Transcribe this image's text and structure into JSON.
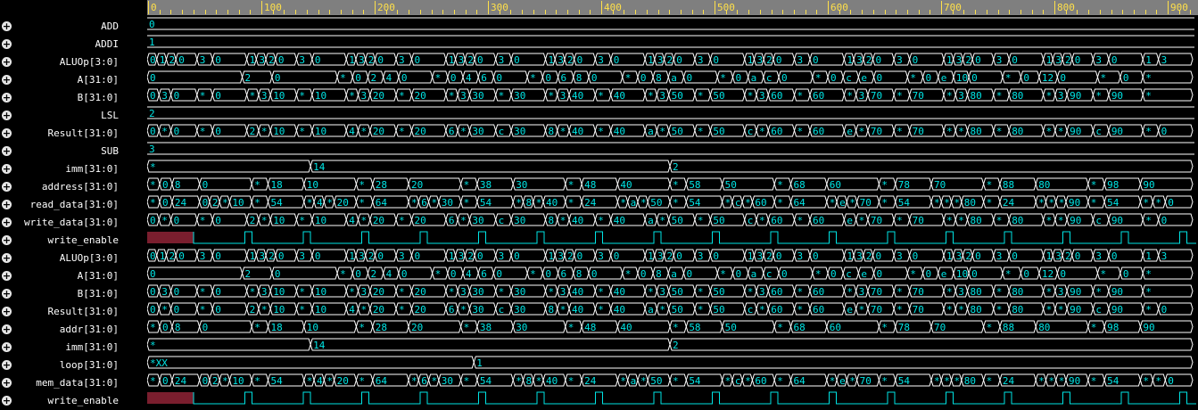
{
  "colors": {
    "wave": "#00e5e5",
    "ruler_bg": "#7f7f7f",
    "ruler_text": "#ffe04a",
    "undefined_fill": "#7a1e2e",
    "name_text": "#ffffff"
  },
  "icons": {
    "expand": "plus-circle-icon"
  },
  "timeline": {
    "ticks": [
      "0",
      "100",
      "200",
      "300",
      "400",
      "500",
      "600",
      "700",
      "800",
      "900"
    ]
  },
  "signals": [
    {
      "name": "ADD",
      "type": "const",
      "value": "0"
    },
    {
      "name": "ADDI",
      "type": "const",
      "value": "1"
    },
    {
      "name": "ALUOp[3:0]",
      "type": "bus",
      "pattern": "alu"
    },
    {
      "name": "A[31:0]",
      "type": "bus",
      "pattern": "a"
    },
    {
      "name": "B[31:0]",
      "type": "bus",
      "pattern": "b"
    },
    {
      "name": "LSL",
      "type": "const",
      "value": "2"
    },
    {
      "name": "Result[31:0]",
      "type": "bus",
      "pattern": "res"
    },
    {
      "name": "SUB",
      "type": "const",
      "value": "3"
    },
    {
      "name": "imm[31:0]",
      "type": "bus",
      "pattern": "imm"
    },
    {
      "name": "address[31:0]",
      "type": "bus",
      "pattern": "addr"
    },
    {
      "name": "read_data[31:0]",
      "type": "bus",
      "pattern": "rd"
    },
    {
      "name": "write_data[31:0]",
      "type": "bus",
      "pattern": "wd"
    },
    {
      "name": "write_enable",
      "type": "bit"
    },
    {
      "name": "ALUOp[3:0]",
      "type": "bus",
      "pattern": "alu"
    },
    {
      "name": "A[31:0]",
      "type": "bus",
      "pattern": "a"
    },
    {
      "name": "B[31:0]",
      "type": "bus",
      "pattern": "b"
    },
    {
      "name": "Result[31:0]",
      "type": "bus",
      "pattern": "res"
    },
    {
      "name": "addr[31:0]",
      "type": "bus",
      "pattern": "addr"
    },
    {
      "name": "imm[31:0]",
      "type": "bus",
      "pattern": "imm"
    },
    {
      "name": "loop[31:0]",
      "type": "bus",
      "pattern": "loop"
    },
    {
      "name": "mem_data[31:0]",
      "type": "bus",
      "pattern": "rd"
    },
    {
      "name": "write_enable",
      "type": "bit"
    }
  ],
  "patterns": {
    "alu": [
      [
        "0",
        "1",
        "2",
        "0"
      ],
      [
        "3",
        "0"
      ],
      [
        "1",
        "3",
        "2",
        "0"
      ],
      [
        "3",
        "0"
      ],
      [
        "1",
        "3",
        "2",
        "0"
      ],
      [
        "3",
        "0"
      ],
      [
        "1",
        "3",
        "2",
        "0"
      ],
      [
        "3",
        "0"
      ],
      [
        "1",
        "3",
        "2",
        "0"
      ],
      [
        "3",
        "0"
      ],
      [
        "1",
        "3",
        "2",
        "0"
      ],
      [
        "3",
        "0"
      ],
      [
        "1",
        "3",
        "2",
        "0"
      ],
      [
        "3",
        "0"
      ],
      [
        "1",
        "3",
        "2",
        "0"
      ],
      [
        "3",
        "0"
      ],
      [
        "1",
        "3",
        "2",
        "0"
      ],
      [
        "3",
        "0"
      ],
      [
        "1",
        "3",
        "2",
        "0"
      ],
      [
        "3",
        "0"
      ],
      [
        "1",
        "3"
      ]
    ],
    "a": [
      [
        "0"
      ],
      [
        "2",
        "0"
      ],
      [
        "*",
        "0",
        "2",
        "4",
        "0"
      ],
      [
        "*",
        "0",
        "4",
        "6",
        "0"
      ],
      [
        "*",
        "0",
        "6",
        "8",
        "0"
      ],
      [
        "*",
        "0",
        "8",
        "a",
        "0"
      ],
      [
        "*",
        "0",
        "a",
        "c",
        "0"
      ],
      [
        "*",
        "0",
        "c",
        "e",
        "0"
      ],
      [
        "*",
        "0",
        "e",
        "10",
        "0"
      ],
      [
        "*",
        "0",
        "12",
        "0"
      ],
      [
        "*",
        "0",
        "*"
      ]
    ],
    "b": [
      [
        "0",
        "3",
        "0"
      ],
      [
        "*",
        "0"
      ],
      [
        "*",
        "3",
        "10"
      ],
      [
        "*",
        "10"
      ],
      [
        "*",
        "3",
        "20"
      ],
      [
        "*",
        "20"
      ],
      [
        "*",
        "3",
        "30"
      ],
      [
        "*",
        "30"
      ],
      [
        "*",
        "3",
        "40"
      ],
      [
        "*",
        "40"
      ],
      [
        "*",
        "3",
        "50"
      ],
      [
        "*",
        "50"
      ],
      [
        "*",
        "3",
        "60"
      ],
      [
        "*",
        "60"
      ],
      [
        "*",
        "3",
        "70"
      ],
      [
        "*",
        "70"
      ],
      [
        "*",
        "3",
        "80"
      ],
      [
        "*",
        "80"
      ],
      [
        "*",
        "3",
        "90"
      ],
      [
        "*",
        "90"
      ],
      [
        "*"
      ]
    ],
    "res": [
      [
        "0",
        "*",
        "0"
      ],
      [
        "*",
        "0"
      ],
      [
        "2",
        "*",
        "10"
      ],
      [
        "*",
        "10"
      ],
      [
        "4",
        "*",
        "20"
      ],
      [
        "*",
        "20"
      ],
      [
        "6",
        "*",
        "30"
      ],
      [
        "c",
        "30"
      ],
      [
        "8",
        "*",
        "40"
      ],
      [
        "*",
        "40"
      ],
      [
        "a",
        "*",
        "50"
      ],
      [
        "*",
        "50"
      ],
      [
        "c",
        "*",
        "60"
      ],
      [
        "*",
        "60"
      ],
      [
        "e",
        "*",
        "70"
      ],
      [
        "*",
        "70"
      ],
      [
        "*",
        "*",
        "80"
      ],
      [
        "*",
        "80"
      ],
      [
        "*",
        "*",
        "90"
      ],
      [
        "c",
        "90"
      ],
      [
        "*",
        "0"
      ]
    ],
    "imm": [
      [
        "*",
        "14"
      ],
      [
        "2"
      ]
    ],
    "addr": [
      [
        "*_XXXX",
        "0",
        "8"
      ],
      [
        "0"
      ],
      [
        "*",
        "18"
      ],
      [
        "10"
      ],
      [
        "*",
        "28"
      ],
      [
        "20"
      ],
      [
        "*",
        "38"
      ],
      [
        "30"
      ],
      [
        "*",
        "48"
      ],
      [
        "40"
      ],
      [
        "*",
        "58"
      ],
      [
        "50"
      ],
      [
        "*",
        "68"
      ],
      [
        "60"
      ],
      [
        "*",
        "78"
      ],
      [
        "70"
      ],
      [
        "*",
        "88"
      ],
      [
        "80"
      ],
      [
        "*",
        "98"
      ],
      [
        "90"
      ]
    ],
    "rd": [
      [
        "*_XXXX",
        "0",
        "24"
      ],
      [
        "0",
        "2",
        "*",
        "10"
      ],
      [
        "*",
        "54"
      ],
      [
        "*",
        "4",
        "*",
        "20"
      ],
      [
        "*",
        "64"
      ],
      [
        "*",
        "6",
        "*",
        "30"
      ],
      [
        "*",
        "54"
      ],
      [
        "*",
        "8",
        "*",
        "40"
      ],
      [
        "*",
        "24"
      ],
      [
        "*",
        "a",
        "*",
        "50"
      ],
      [
        "*",
        "54"
      ],
      [
        "*",
        "c",
        "*",
        "60"
      ],
      [
        "*",
        "64"
      ],
      [
        "*",
        "e",
        "*",
        "70"
      ],
      [
        "*",
        "54"
      ],
      [
        "*",
        "*",
        "*",
        "80"
      ],
      [
        "*",
        "24"
      ],
      [
        "*",
        "*",
        "*",
        "90"
      ],
      [
        "*",
        "54"
      ],
      [
        "*",
        "*",
        "0"
      ]
    ],
    "wd": [
      [
        "0",
        "*",
        "0"
      ],
      [
        "*",
        "0"
      ],
      [
        "2",
        "*",
        "10"
      ],
      [
        "*",
        "10"
      ],
      [
        "4",
        "*",
        "20"
      ],
      [
        "*",
        "20"
      ],
      [
        "6",
        "*",
        "30"
      ],
      [
        "c",
        "30"
      ],
      [
        "8",
        "*",
        "40"
      ],
      [
        "*",
        "40"
      ],
      [
        "a",
        "*",
        "50"
      ],
      [
        "*",
        "50"
      ],
      [
        "c",
        "*",
        "60"
      ],
      [
        "*",
        "60"
      ],
      [
        "e",
        "*",
        "70"
      ],
      [
        "*",
        "70"
      ],
      [
        "*",
        "*",
        "80"
      ],
      [
        "*",
        "80"
      ],
      [
        "*",
        "*",
        "90"
      ],
      [
        "c",
        "90"
      ],
      [
        "*",
        "0"
      ]
    ],
    "loop": [
      [
        "*XX",
        "1"
      ]
    ]
  }
}
